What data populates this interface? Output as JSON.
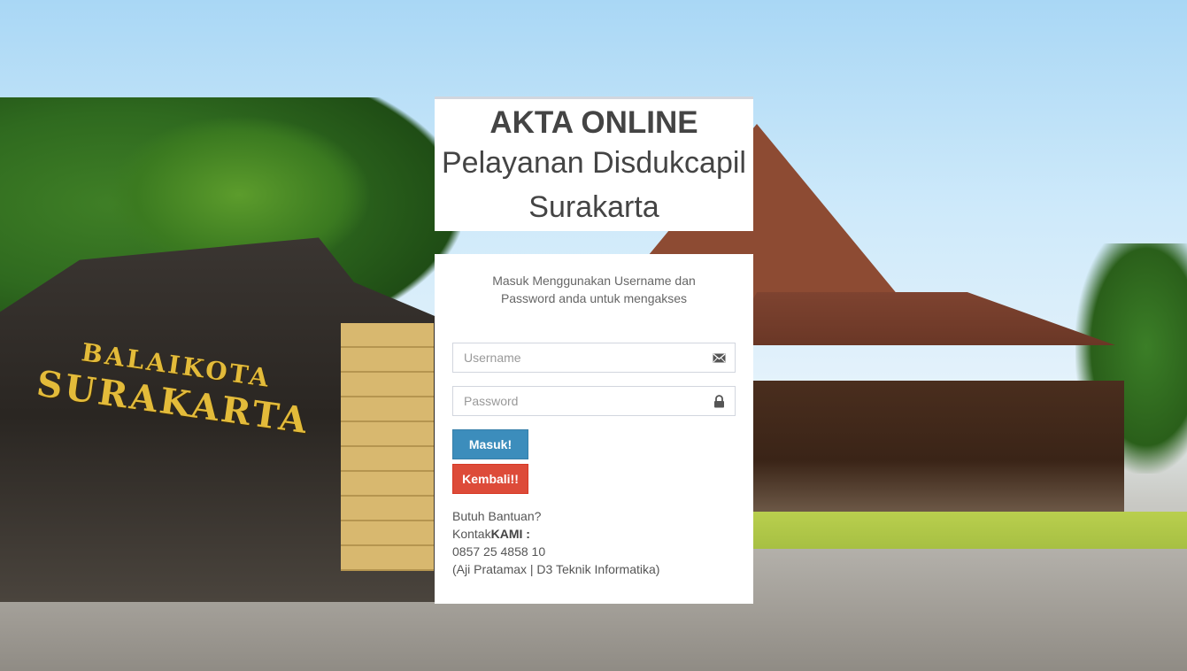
{
  "header": {
    "title": "AKTA ONLINE",
    "subtitle_line1": "Pelayanan Disdukcapil",
    "subtitle_line2": "Surakarta"
  },
  "background": {
    "sign_line1": "BALAIKOTA",
    "sign_line2": "SURAKARTA"
  },
  "login": {
    "message_line1": "Masuk Menggunakan Username dan",
    "message_line2": "Password anda untuk mengakses",
    "username": {
      "placeholder": "Username",
      "value": "",
      "icon": "envelope-icon"
    },
    "password": {
      "placeholder": "Password",
      "value": "",
      "icon": "lock-icon"
    },
    "submit_label": "Masuk!",
    "back_label": "Kembali!!"
  },
  "help": {
    "question": "Butuh Bantuan?",
    "contact_prefix": "Kontak",
    "contact_bold": "KAMI :",
    "phone": "0857 25 4858 10",
    "author": "(Aji Pratamax | D3 Teknik Informatika)"
  },
  "colors": {
    "primary": "#3c8dbc",
    "danger": "#dd4b39",
    "panel": "#ffffff"
  }
}
